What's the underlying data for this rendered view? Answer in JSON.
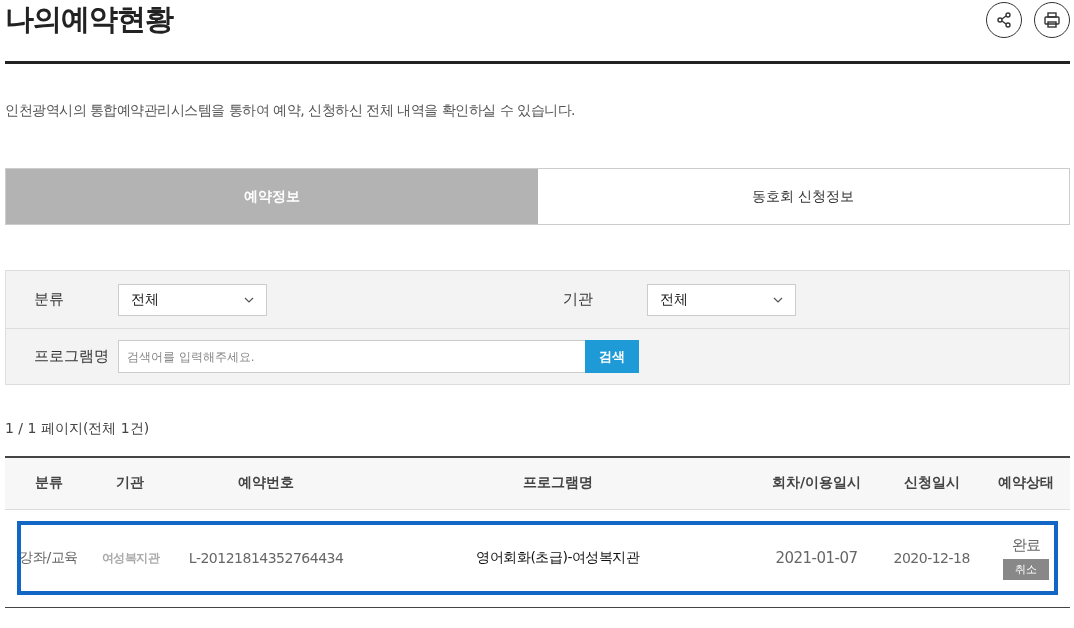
{
  "title": "나의예약현황",
  "header_actions": [
    {
      "kind": "share"
    },
    {
      "kind": "print"
    }
  ],
  "description": "인천광역시의 통합예약관리시스템을 통하여 예약, 신청하신 전체 내역을 확인하실 수 있습니다.",
  "tabs": [
    {
      "label": "예약정보",
      "selected": true
    },
    {
      "label": "동호회 신청정보",
      "selected": false
    }
  ],
  "filters": {
    "category": {
      "label": "분류",
      "value": "전체"
    },
    "agency": {
      "label": "기관",
      "value": "전체"
    },
    "program": {
      "label": "프로그램명",
      "placeholder": "검색어를 입력해주세요.",
      "button": "검색"
    }
  },
  "count": "1 / 1 페이지(전체 1건)",
  "table": {
    "columns": [
      "분류",
      "기관",
      "예약번호",
      "프로그램명",
      "회차/이용일시",
      "신청일시",
      "예약상태"
    ],
    "rows": [
      {
        "selected": true,
        "category": "강좌/교육",
        "agency": "여성복지관",
        "number": "L-20121814352764434",
        "program": "영어회화(초급)-여성복지관",
        "session": "2021-01-07",
        "applied": "2020-12-18",
        "status": "완료",
        "action": "취소"
      }
    ]
  }
}
